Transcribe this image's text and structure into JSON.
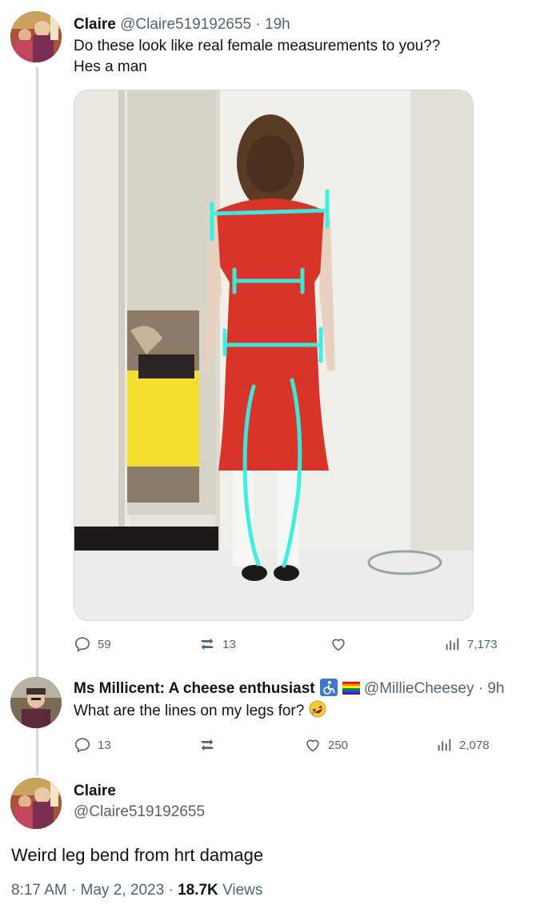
{
  "tweet1": {
    "name": "Claire",
    "handle": "@Claire519192655",
    "time": "· 19h",
    "text_line1": "Do these look like real female measurements to you??",
    "text_line2": "Hes a man",
    "avatar": "painting-avatar",
    "actions": {
      "replies": "59",
      "retweets": "13",
      "likes": "",
      "views": "7,173"
    }
  },
  "reply": {
    "name": "Ms Millicent: A cheese enthusiast",
    "badges": [
      "accessibility-icon",
      "rainbow-flag-icon"
    ],
    "handle": "@MillieCheesey",
    "time": "· 9h",
    "text": "What are the lines on my legs for?",
    "emoji": "rofl-emoji-icon",
    "avatar": "person-avatar",
    "actions": {
      "replies": "13",
      "retweets": "",
      "likes": "250",
      "views": "2,078"
    }
  },
  "main": {
    "name": "Claire",
    "handle": "@Claire519192655",
    "text": "Weird leg bend from hrt damage",
    "time": "8:17 AM",
    "date": "May 2, 2023",
    "views_count": "18.7K",
    "views_label": "Views",
    "separator": "·"
  },
  "colors": {
    "muted": "#536471",
    "thread": "#cfd9de",
    "line_glow": "#35f0e0",
    "dress": "#d8342a"
  }
}
